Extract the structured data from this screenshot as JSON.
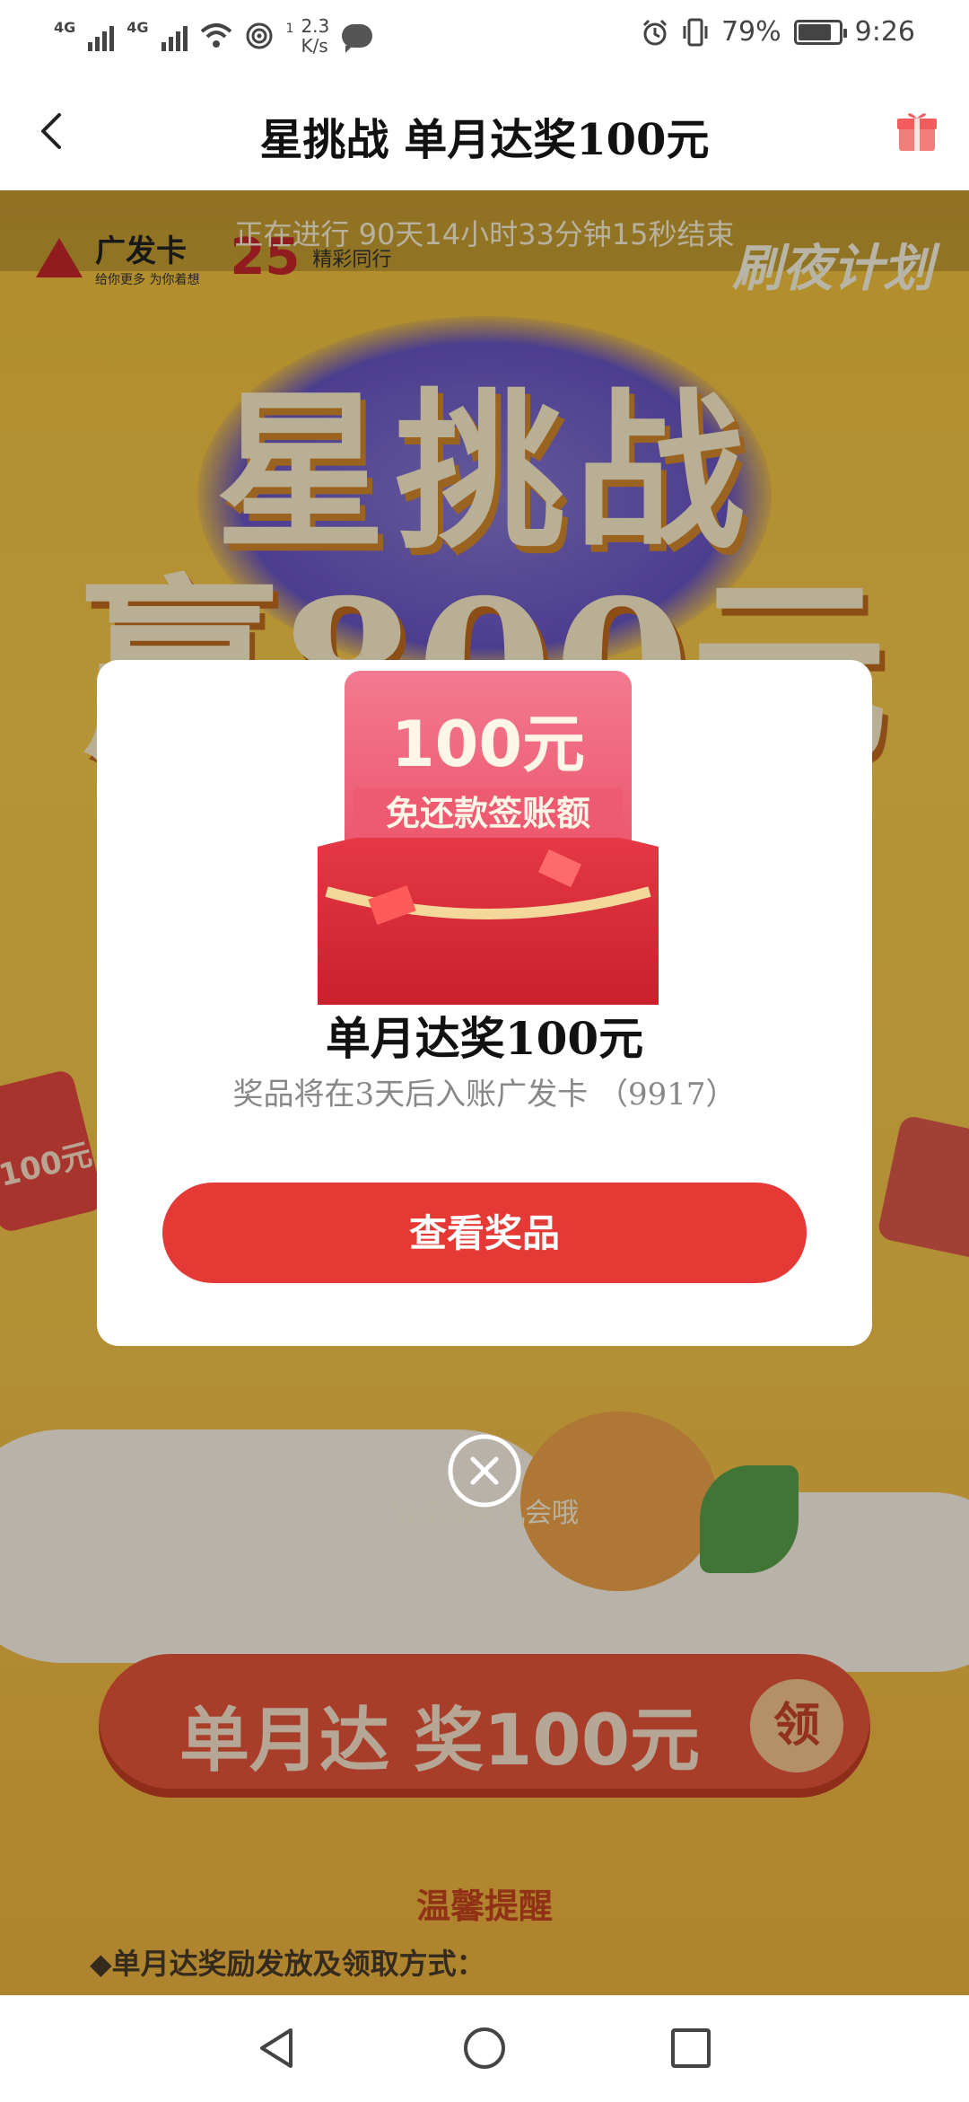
{
  "status_bar": {
    "network_1": "4G",
    "network_2": "4G",
    "network_1_index": "1",
    "speed_value": "2.3",
    "speed_unit": "K/s",
    "battery": "79%",
    "time": "9:26"
  },
  "title_bar": {
    "title": "星挑战 单月达奖100元"
  },
  "background": {
    "brand_name": "广发卡",
    "brand_slogan": "给你更多 为你着想",
    "anniversary": "25",
    "anniversary_tag": "精彩同行",
    "countdown": "正在进行 90天14小时33分钟15秒结束",
    "plan_label": "刷夜计划",
    "hero_line1": "星挑战",
    "hero_line2": "赢800元",
    "red_envelope_amount": "100元",
    "no_chance_text": "暂无抽奖机会哦",
    "claim_button_text": "单月达 奖100元",
    "claim_button_badge": "领",
    "tips_heading": "温馨提醒",
    "tips_item1": "◆单月达奖励发放及领取方式："
  },
  "modal": {
    "image_amount": "100元",
    "image_caption": "免还款签账额",
    "prize_title": "单月达奖100元",
    "prize_subtitle": "奖品将在3天后入账广发卡 （9917）",
    "view_button": "查看奖品"
  },
  "colors": {
    "accent_red": "#e53935",
    "background_gold": "#f6c33c"
  }
}
